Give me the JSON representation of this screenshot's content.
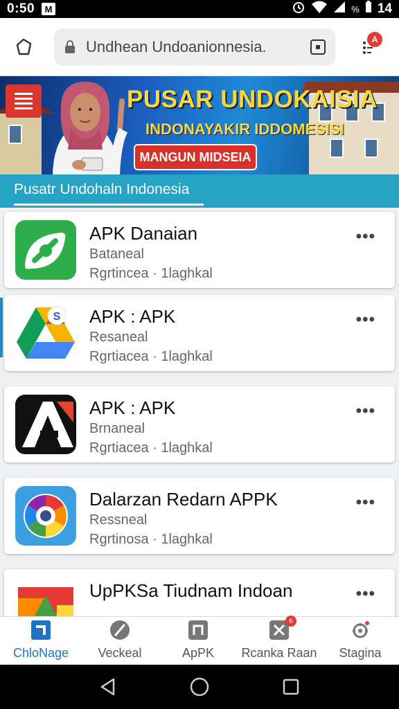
{
  "status_bar": {
    "time": "0:50",
    "left_badge": "M",
    "battery_label": "%",
    "number": "14",
    "icons": [
      "alarm-icon",
      "wifi-icon",
      "signal-icon",
      "battery-icon"
    ]
  },
  "browser": {
    "url": "Undhean Undoanionnesia.",
    "icons": [
      "home-icon",
      "lock-icon",
      "tabs-icon",
      "menu-icon"
    ],
    "menu_badge": "A"
  },
  "banner": {
    "title": "PUSAR UNDOKAISIA",
    "subtitle": "INDONAYAKIR IDDOMESISI",
    "button_label": "MANGUN MIDSEIA"
  },
  "section": {
    "title": "Pusatr Undohaln Indonesia"
  },
  "apps": [
    {
      "name": "APK Danaian",
      "developer": "Bataneal",
      "meta": "Rgrtincea · 1laghkal",
      "icon": "green-leaf-icon"
    },
    {
      "name": "APK : APK",
      "developer": "Resaneal",
      "meta": "Rgrtiacea · 1laghkal",
      "icon": "triangle-drive-icon"
    },
    {
      "name": "APK : APK",
      "developer": "Brnaneal",
      "meta": "Rgrtiacea · 1laghkal",
      "icon": "black-a-icon"
    },
    {
      "name": "Dalarzan Redarn APPK",
      "developer": "Ressneal",
      "meta": "Rgrtinosa · 1laghkal",
      "icon": "color-wheel-icon"
    },
    {
      "name": "UpPKSa Tiudnam Indoan",
      "developer": "",
      "meta": "",
      "icon": "colorful-blocks-icon"
    }
  ],
  "more_label": "•••",
  "bottom_nav": [
    {
      "label": "ChloNage",
      "icon": "home-square-icon",
      "active": true
    },
    {
      "label": "Veckeal",
      "icon": "compass-icon",
      "active": false
    },
    {
      "label": "ApPK",
      "icon": "apps-icon",
      "active": false
    },
    {
      "label": "Rcanka Raan",
      "icon": "tools-icon",
      "active": false,
      "badge": "6"
    },
    {
      "label": "Stagina",
      "icon": "settings-icon",
      "active": false
    }
  ],
  "colors": {
    "section_bg": "#26a3c4",
    "banner_title": "#ffd633",
    "accent": "#1e73c8",
    "badge": "#e53935"
  }
}
